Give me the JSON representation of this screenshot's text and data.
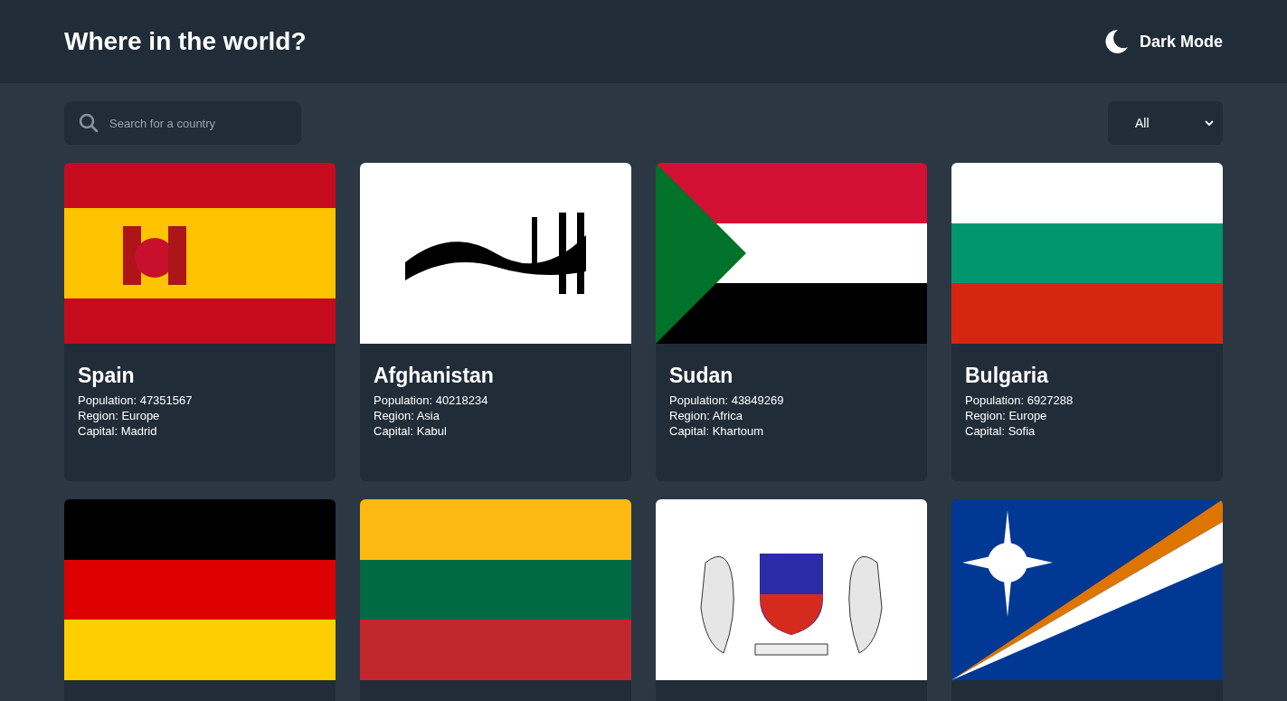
{
  "header": {
    "title": "Where in the world?",
    "mode_toggle": "Dark Mode"
  },
  "search": {
    "placeholder": "Search for a country"
  },
  "region_filter": {
    "value": "All"
  },
  "countries": [
    {
      "name": "Spain",
      "population": "Population: 47351567",
      "region": "Region: Europe",
      "capital": "Capital: Madrid",
      "flag": {
        "kind": "picture"
      }
    },
    {
      "name": "Afghanistan",
      "population": "Population: 40218234",
      "region": "Region: Asia",
      "capital": "Capital: Kabul",
      "flag": {
        "kind": "picture"
      }
    },
    {
      "name": "Sudan",
      "population": "Population: 43849269",
      "region": "Region: Africa",
      "capital": "Capital: Khartoum",
      "flag": {
        "kind": "picture"
      }
    },
    {
      "name": "Bulgaria",
      "population": "Population: 6927288",
      "region": "Region: Europe",
      "capital": "Capital: Sofia",
      "flag": {
        "kind": "picture"
      }
    },
    {
      "flag": {
        "kind": "picture"
      }
    },
    {
      "flag": {
        "kind": "picture"
      }
    },
    {
      "flag": {
        "kind": "picture"
      }
    },
    {
      "flag": {
        "kind": "picture"
      }
    }
  ]
}
